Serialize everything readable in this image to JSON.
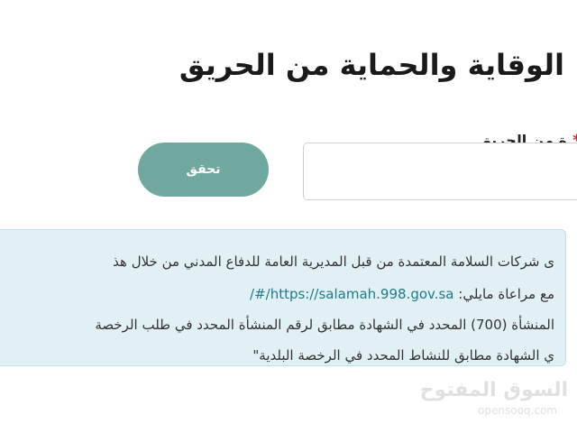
{
  "page": {
    "heading": "الوقاية والحماية من الحريق"
  },
  "form": {
    "field_label": "ة من الحريق",
    "required_mark": "*",
    "input_value": "",
    "verify_button": "تحقق"
  },
  "info": {
    "line1": "ى شركات السلامة المعتمدة من قبل المديرية العامة للدفاع المدني من خلال هذ",
    "line2_link": "https://salamah.998.gov.sa/#/",
    "line2_text": "مع مراعاة مايلي:",
    "line3": "المنشأة (700) المحدد في الشهادة مطابق لرقم المنشأة المحدد في طلب الرخصة",
    "line4": "ي الشهادة مطابق للنشاط المحدد في الرخصة البلدية\""
  },
  "watermark": {
    "logo_text": "السوق المفتوح",
    "url": "opensooq.com"
  }
}
